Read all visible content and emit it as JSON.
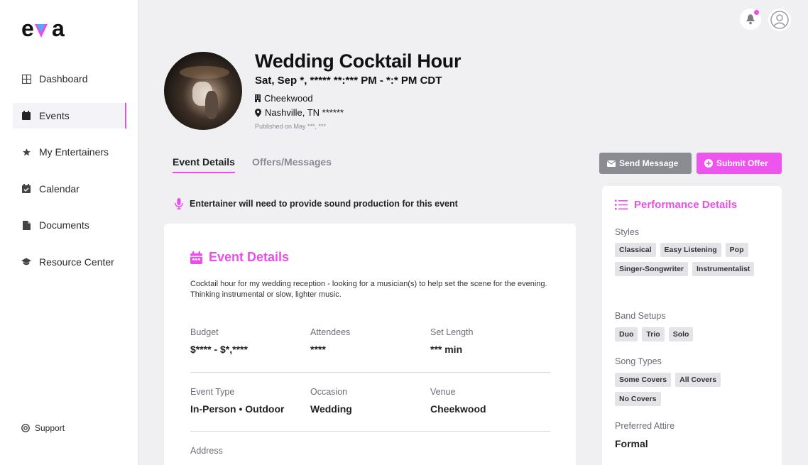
{
  "brand": {
    "logo_text": "eva",
    "accent": "#e94ee9"
  },
  "sidebar": {
    "items": [
      {
        "label": "Dashboard",
        "icon": "dashboard-icon",
        "active": false
      },
      {
        "label": "Events",
        "icon": "calendar-icon",
        "active": true
      },
      {
        "label": "My Entertainers",
        "icon": "star-icon",
        "active": false
      },
      {
        "label": "Calendar",
        "icon": "calendar-check-icon",
        "active": false
      },
      {
        "label": "Documents",
        "icon": "document-icon",
        "active": false
      },
      {
        "label": "Resource Center",
        "icon": "graduation-cap-icon",
        "active": false
      }
    ],
    "support_label": "Support"
  },
  "event": {
    "title": "Wedding Cocktail Hour",
    "datetime": "Sat, Sep *, ***** **:*** PM - *:* PM CDT",
    "venue": "Cheekwood",
    "location": "Nashville, TN ******",
    "published": "Published on May ***, ***"
  },
  "tabs": [
    {
      "label": "Event Details",
      "active": true
    },
    {
      "label": "Offers/Messages",
      "active": false
    }
  ],
  "actions": {
    "send_message": "Send Message",
    "submit_offer": "Submit Offer"
  },
  "notice": "Entertainer will need to provide sound production for this event",
  "details": {
    "title": "Event Details",
    "description": "Cocktail hour for my wedding reception - looking for a musician(s) to help set the scene for the evening. Thinking instrumental or slow, lighter music.",
    "budget_label": "Budget",
    "budget_value": "$**** - $*,****",
    "attendees_label": "Attendees",
    "attendees_value": "****",
    "set_length_label": "Set Length",
    "set_length_value": "*** min",
    "event_type_label": "Event Type",
    "event_type_value": "In-Person • Outdoor",
    "occasion_label": "Occasion",
    "occasion_value": "Wedding",
    "venue_label": "Venue",
    "venue_value": "Cheekwood",
    "address_label": "Address"
  },
  "performance": {
    "title": "Performance Details",
    "styles_label": "Styles",
    "styles": [
      "Classical",
      "Easy Listening",
      "Pop",
      "Singer-Songwriter",
      "Instrumentalist"
    ],
    "band_label": "Band Setups",
    "band": [
      "Duo",
      "Trio",
      "Solo"
    ],
    "song_label": "Song Types",
    "songs": [
      "Some Covers",
      "All Covers",
      "No Covers"
    ],
    "attire_label": "Preferred Attire",
    "attire_value": "Formal"
  }
}
